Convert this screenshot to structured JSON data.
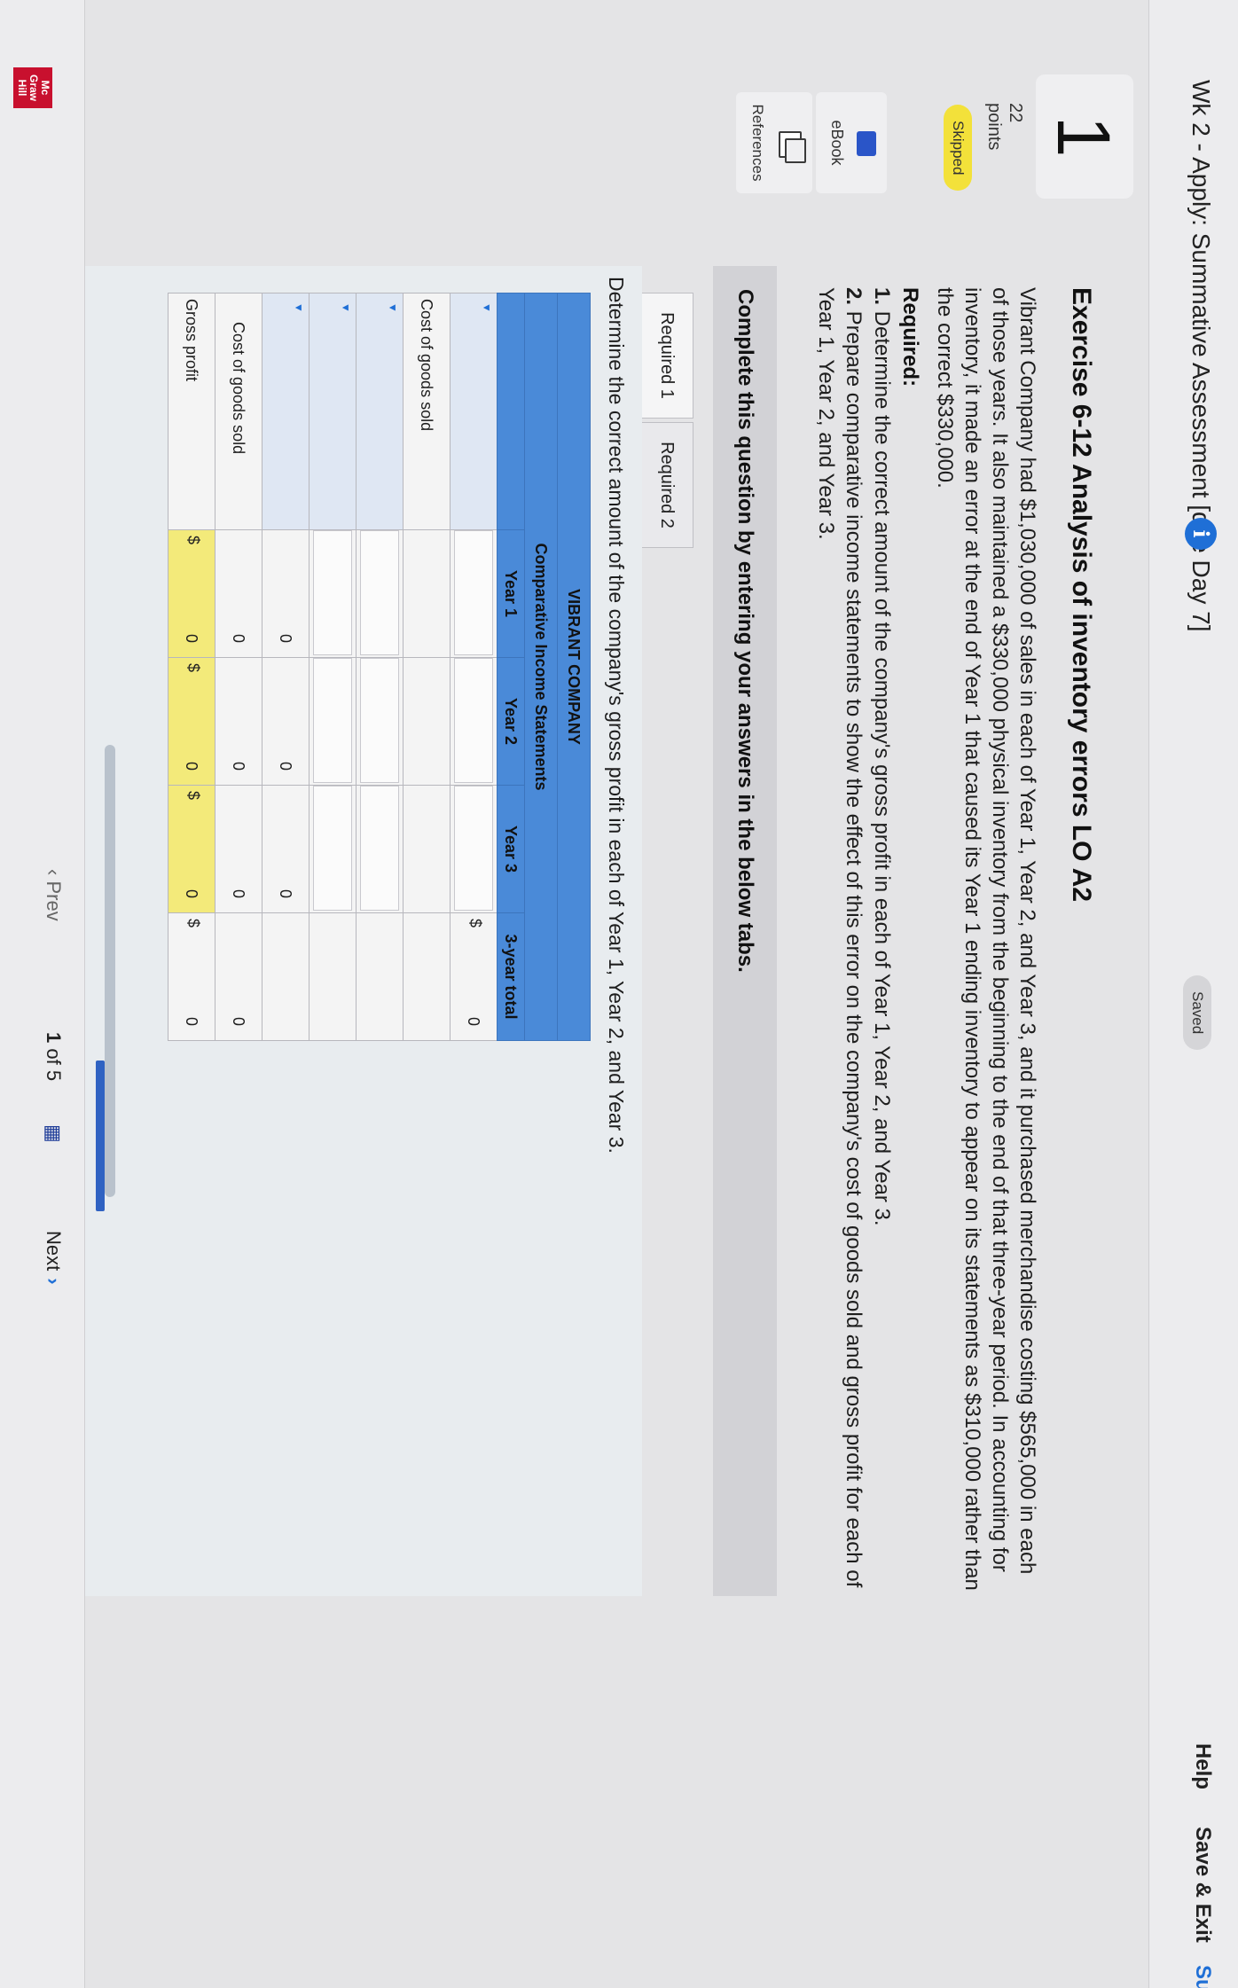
{
  "header": {
    "title": "Wk 2 - Apply: Summative Assessment [due Day 7]",
    "info_icon": "i",
    "saved": "Saved",
    "help": "Help",
    "save_exit": "Save & Exit",
    "submit_partial": "Su"
  },
  "question": {
    "number": "1",
    "points_value": "22",
    "points_label": "points",
    "status": "Skipped",
    "ebook": "eBook",
    "references": "References",
    "title": "Exercise 6-12 Analysis of inventory errors LO A2",
    "paragraph": "Vibrant Company had $1,030,000 of sales in each of Year 1, Year 2, and Year 3, and it purchased merchandise costing $565,000 in each of those years. It also maintained a $330,000 physical inventory from the beginning to the end of that three-year period. In accounting for inventory, it made an error at the end of Year 1 that caused its Year 1 ending inventory to appear on its statements as $310,000 rather than the correct $330,000.",
    "required_heading": "Required:",
    "required_1_num": "1.",
    "required_1": " Determine the correct amount of the company's gross profit in each of Year 1, Year 2, and Year 3.",
    "required_2_num": "2.",
    "required_2": " Prepare comparative income statements to show the effect of this error on the company's cost of goods sold and gross profit for each of Year 1, Year 2, and Year 3."
  },
  "instructions": "Complete this question by entering your answers in the below tabs.",
  "tabs": [
    "Required 1",
    "Required 2"
  ],
  "content_instruction": "Determine the correct amount of the company's gross profit in each of Year 1, Year 2, and Year 3.",
  "table": {
    "company": "VIBRANT COMPANY",
    "statement": "Comparative Income Statements",
    "columns": [
      "Year 1",
      "Year 2",
      "Year 3",
      "3-year total"
    ],
    "row_cogs_label": "Cost of goods sold",
    "row_cogs_sub": "Cost of goods sold",
    "row_gross": "Gross profit",
    "currency": "$",
    "zero": "0"
  },
  "footer": {
    "logo": "Mc Graw Hill",
    "prev": "Prev",
    "page_current": "1",
    "page_of": "of 5",
    "next": "Next"
  },
  "colors": {
    "accent_blue": "#1f6fd6",
    "table_header": "#4a8ad8",
    "skipped_badge": "#f3e13a",
    "money_highlight": "#f3ea7a"
  }
}
